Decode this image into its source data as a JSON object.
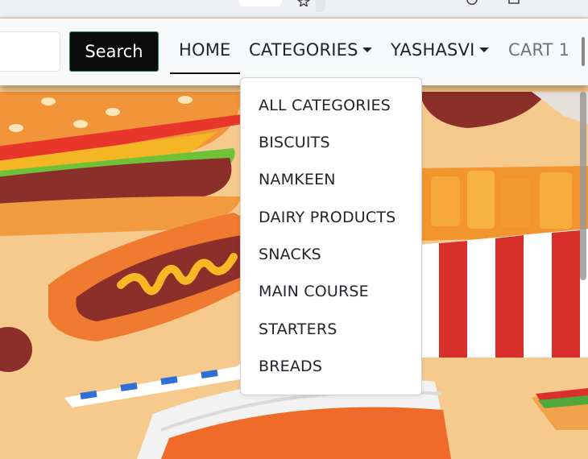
{
  "colors": {
    "navbar_bg": "#f8f9fa",
    "search_button_bg": "#0b0b0b",
    "search_button_border": "#1f8a4a",
    "text": "#212529",
    "muted": "#6c757d",
    "hero_bg": "#f6c98c"
  },
  "browser": {
    "icons": [
      "star-icon",
      "refresh-icon",
      "bag-icon"
    ]
  },
  "search": {
    "placeholder": "",
    "value": "",
    "button_label": "Search"
  },
  "nav": {
    "home": "HOME",
    "categories": "CATEGORIES",
    "user": "YASHASVI",
    "cart": "CART 1"
  },
  "dropdown": {
    "items": [
      "ALL CATEGORIES",
      "BISCUITS",
      "NAMKEEN",
      "DAIRY PRODUCTS",
      "SNACKS",
      "MAIN COURSE",
      "STARTERS",
      "BREADS"
    ]
  }
}
